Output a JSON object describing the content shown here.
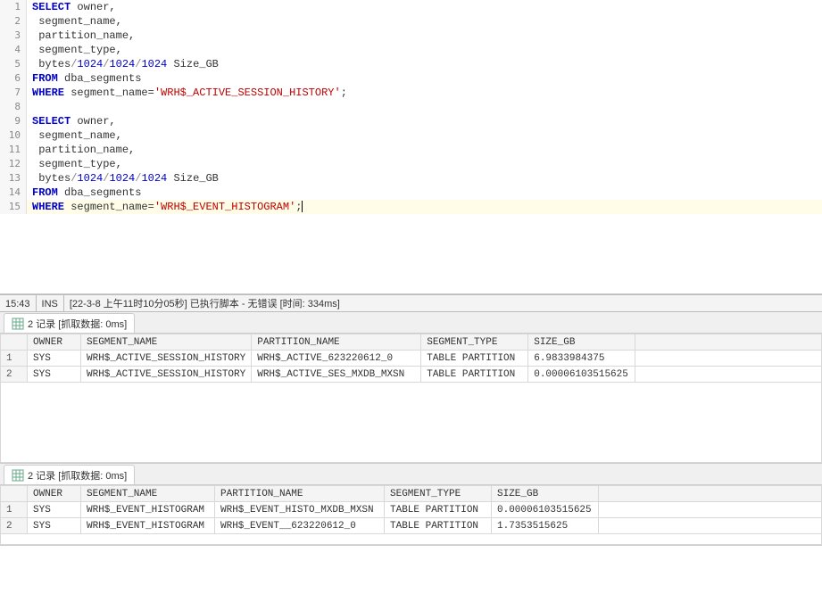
{
  "editor": {
    "lines": [
      {
        "n": 1,
        "tokens": [
          {
            "t": "SELECT",
            "c": "kw"
          },
          {
            "t": " owner,",
            "c": ""
          }
        ]
      },
      {
        "n": 2,
        "tokens": [
          {
            "t": " segment_name,",
            "c": ""
          }
        ]
      },
      {
        "n": 3,
        "tokens": [
          {
            "t": " partition_name,",
            "c": ""
          }
        ]
      },
      {
        "n": 4,
        "tokens": [
          {
            "t": " segment_type,",
            "c": ""
          }
        ]
      },
      {
        "n": 5,
        "tokens": [
          {
            "t": " bytes",
            "c": ""
          },
          {
            "t": "/",
            "c": "op"
          },
          {
            "t": "1024",
            "c": "num"
          },
          {
            "t": "/",
            "c": "op"
          },
          {
            "t": "1024",
            "c": "num"
          },
          {
            "t": "/",
            "c": "op"
          },
          {
            "t": "1024",
            "c": "num"
          },
          {
            "t": " Size_GB",
            "c": ""
          }
        ]
      },
      {
        "n": 6,
        "tokens": [
          {
            "t": "FROM",
            "c": "kw"
          },
          {
            "t": " dba_segments",
            "c": ""
          }
        ]
      },
      {
        "n": 7,
        "tokens": [
          {
            "t": "WHERE",
            "c": "kw"
          },
          {
            "t": " segment_name=",
            "c": ""
          },
          {
            "t": "'WRH$_ACTIVE_SESSION_HISTORY'",
            "c": "str"
          },
          {
            "t": ";",
            "c": ""
          }
        ]
      },
      {
        "n": 8,
        "tokens": []
      },
      {
        "n": 9,
        "tokens": [
          {
            "t": "SELECT",
            "c": "kw"
          },
          {
            "t": " owner,",
            "c": ""
          }
        ]
      },
      {
        "n": 10,
        "tokens": [
          {
            "t": " segment_name,",
            "c": ""
          }
        ]
      },
      {
        "n": 11,
        "tokens": [
          {
            "t": " partition_name,",
            "c": ""
          }
        ]
      },
      {
        "n": 12,
        "tokens": [
          {
            "t": " segment_type,",
            "c": ""
          }
        ]
      },
      {
        "n": 13,
        "tokens": [
          {
            "t": " bytes",
            "c": ""
          },
          {
            "t": "/",
            "c": "op"
          },
          {
            "t": "1024",
            "c": "num"
          },
          {
            "t": "/",
            "c": "op"
          },
          {
            "t": "1024",
            "c": "num"
          },
          {
            "t": "/",
            "c": "op"
          },
          {
            "t": "1024",
            "c": "num"
          },
          {
            "t": " Size_GB",
            "c": ""
          }
        ]
      },
      {
        "n": 14,
        "tokens": [
          {
            "t": "FROM",
            "c": "kw"
          },
          {
            "t": " dba_segments",
            "c": ""
          }
        ]
      },
      {
        "n": 15,
        "hl": true,
        "cursor": true,
        "tokens": [
          {
            "t": "WHERE",
            "c": "kw"
          },
          {
            "t": " segment_name=",
            "c": ""
          },
          {
            "t": "'WRH$_EVENT_HISTOGRAM'",
            "c": "str"
          },
          {
            "t": ";",
            "c": ""
          }
        ]
      }
    ]
  },
  "status": {
    "pos": "15:43",
    "mode": "INS",
    "message": "[22-3-8 上午11时10分05秒] 已执行脚本 - 无错误  [时间: 334ms]"
  },
  "result1": {
    "tab_label": "2 记录 [抓取数据: 0ms]",
    "columns": [
      "OWNER",
      "SEGMENT_NAME",
      "PARTITION_NAME",
      "SEGMENT_TYPE",
      "SIZE_GB"
    ],
    "rows": [
      {
        "n": 1,
        "owner": "SYS",
        "seg": "WRH$_ACTIVE_SESSION_HISTORY",
        "part": "WRH$_ACTIVE_623220612_0",
        "type": "TABLE PARTITION",
        "size": "6.9833984375"
      },
      {
        "n": 2,
        "owner": "SYS",
        "seg": "WRH$_ACTIVE_SESSION_HISTORY",
        "part": "WRH$_ACTIVE_SES_MXDB_MXSN",
        "type": "TABLE PARTITION",
        "size": "0.00006103515625"
      }
    ]
  },
  "result2": {
    "tab_label": "2 记录 [抓取数据: 0ms]",
    "columns": [
      "OWNER",
      "SEGMENT_NAME",
      "PARTITION_NAME",
      "SEGMENT_TYPE",
      "SIZE_GB"
    ],
    "rows": [
      {
        "n": 1,
        "owner": "SYS",
        "seg": "WRH$_EVENT_HISTOGRAM",
        "part": "WRH$_EVENT_HISTO_MXDB_MXSN",
        "type": "TABLE PARTITION",
        "size": "0.00006103515625"
      },
      {
        "n": 2,
        "owner": "SYS",
        "seg": "WRH$_EVENT_HISTOGRAM",
        "part": "WRH$_EVENT__623220612_0",
        "type": "TABLE PARTITION",
        "size": "1.7353515625"
      }
    ]
  }
}
